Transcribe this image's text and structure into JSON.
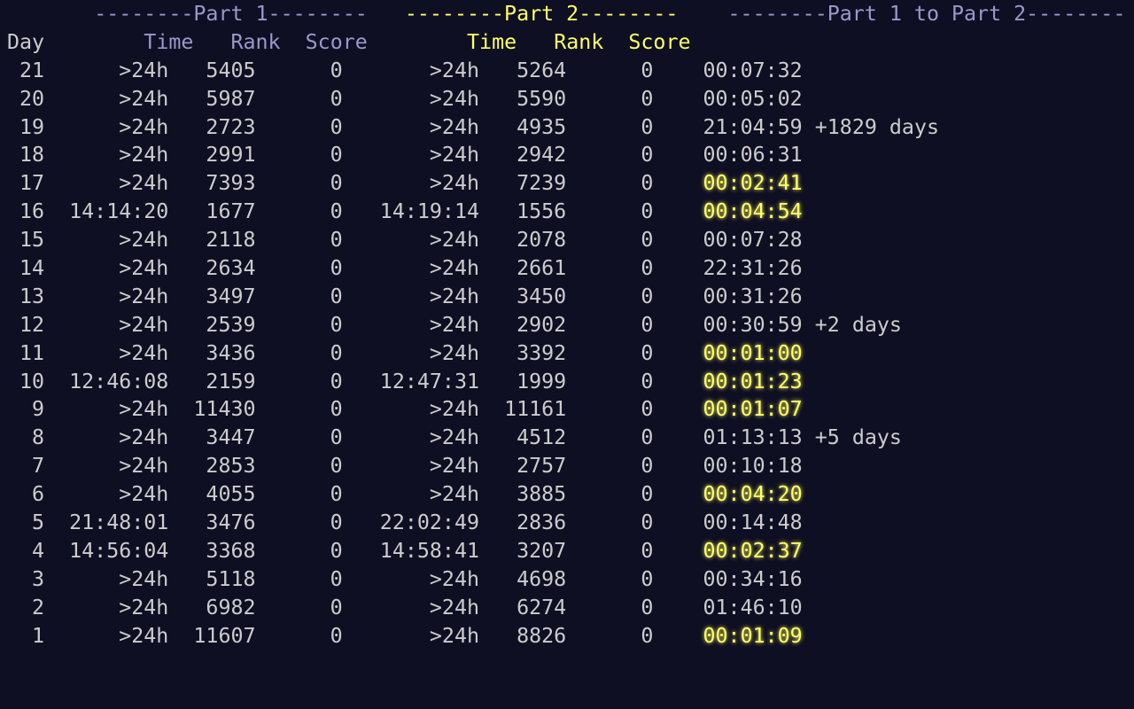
{
  "colors": {
    "background": "#0f0f23",
    "text": "#cccccc",
    "part1_header": "#9999cc",
    "part2_header": "#ffff66",
    "fast_delta": "#ffff66"
  },
  "groups": {
    "part1": "--------Part 1--------",
    "part2": "--------Part 2--------",
    "delta": "--------Part 1 to Part 2--------"
  },
  "headers": {
    "day": "Day",
    "p1_time": "Time",
    "p1_rank": "Rank",
    "p1_score": "Score",
    "p2_time": "Time",
    "p2_rank": "Rank",
    "p2_score": "Score"
  },
  "rows": [
    {
      "day": "21",
      "p1_time": ">24h",
      "p1_rank": "5405",
      "p1_score": "0",
      "p2_time": ">24h",
      "p2_rank": "5264",
      "p2_score": "0",
      "delta": "00:07:32",
      "extra": "",
      "fast": false
    },
    {
      "day": "20",
      "p1_time": ">24h",
      "p1_rank": "5987",
      "p1_score": "0",
      "p2_time": ">24h",
      "p2_rank": "5590",
      "p2_score": "0",
      "delta": "00:05:02",
      "extra": "",
      "fast": false
    },
    {
      "day": "19",
      "p1_time": ">24h",
      "p1_rank": "2723",
      "p1_score": "0",
      "p2_time": ">24h",
      "p2_rank": "4935",
      "p2_score": "0",
      "delta": "21:04:59",
      "extra": "+1829 days",
      "fast": false
    },
    {
      "day": "18",
      "p1_time": ">24h",
      "p1_rank": "2991",
      "p1_score": "0",
      "p2_time": ">24h",
      "p2_rank": "2942",
      "p2_score": "0",
      "delta": "00:06:31",
      "extra": "",
      "fast": false
    },
    {
      "day": "17",
      "p1_time": ">24h",
      "p1_rank": "7393",
      "p1_score": "0",
      "p2_time": ">24h",
      "p2_rank": "7239",
      "p2_score": "0",
      "delta": "00:02:41",
      "extra": "",
      "fast": true
    },
    {
      "day": "16",
      "p1_time": "14:14:20",
      "p1_rank": "1677",
      "p1_score": "0",
      "p2_time": "14:19:14",
      "p2_rank": "1556",
      "p2_score": "0",
      "delta": "00:04:54",
      "extra": "",
      "fast": true
    },
    {
      "day": "15",
      "p1_time": ">24h",
      "p1_rank": "2118",
      "p1_score": "0",
      "p2_time": ">24h",
      "p2_rank": "2078",
      "p2_score": "0",
      "delta": "00:07:28",
      "extra": "",
      "fast": false
    },
    {
      "day": "14",
      "p1_time": ">24h",
      "p1_rank": "2634",
      "p1_score": "0",
      "p2_time": ">24h",
      "p2_rank": "2661",
      "p2_score": "0",
      "delta": "22:31:26",
      "extra": "",
      "fast": false
    },
    {
      "day": "13",
      "p1_time": ">24h",
      "p1_rank": "3497",
      "p1_score": "0",
      "p2_time": ">24h",
      "p2_rank": "3450",
      "p2_score": "0",
      "delta": "00:31:26",
      "extra": "",
      "fast": false
    },
    {
      "day": "12",
      "p1_time": ">24h",
      "p1_rank": "2539",
      "p1_score": "0",
      "p2_time": ">24h",
      "p2_rank": "2902",
      "p2_score": "0",
      "delta": "00:30:59",
      "extra": "+2 days",
      "fast": false
    },
    {
      "day": "11",
      "p1_time": ">24h",
      "p1_rank": "3436",
      "p1_score": "0",
      "p2_time": ">24h",
      "p2_rank": "3392",
      "p2_score": "0",
      "delta": "00:01:00",
      "extra": "",
      "fast": true
    },
    {
      "day": "10",
      "p1_time": "12:46:08",
      "p1_rank": "2159",
      "p1_score": "0",
      "p2_time": "12:47:31",
      "p2_rank": "1999",
      "p2_score": "0",
      "delta": "00:01:23",
      "extra": "",
      "fast": true
    },
    {
      "day": "9",
      "p1_time": ">24h",
      "p1_rank": "11430",
      "p1_score": "0",
      "p2_time": ">24h",
      "p2_rank": "11161",
      "p2_score": "0",
      "delta": "00:01:07",
      "extra": "",
      "fast": true
    },
    {
      "day": "8",
      "p1_time": ">24h",
      "p1_rank": "3447",
      "p1_score": "0",
      "p2_time": ">24h",
      "p2_rank": "4512",
      "p2_score": "0",
      "delta": "01:13:13",
      "extra": "+5 days",
      "fast": false
    },
    {
      "day": "7",
      "p1_time": ">24h",
      "p1_rank": "2853",
      "p1_score": "0",
      "p2_time": ">24h",
      "p2_rank": "2757",
      "p2_score": "0",
      "delta": "00:10:18",
      "extra": "",
      "fast": false
    },
    {
      "day": "6",
      "p1_time": ">24h",
      "p1_rank": "4055",
      "p1_score": "0",
      "p2_time": ">24h",
      "p2_rank": "3885",
      "p2_score": "0",
      "delta": "00:04:20",
      "extra": "",
      "fast": true
    },
    {
      "day": "5",
      "p1_time": "21:48:01",
      "p1_rank": "3476",
      "p1_score": "0",
      "p2_time": "22:02:49",
      "p2_rank": "2836",
      "p2_score": "0",
      "delta": "00:14:48",
      "extra": "",
      "fast": false
    },
    {
      "day": "4",
      "p1_time": "14:56:04",
      "p1_rank": "3368",
      "p1_score": "0",
      "p2_time": "14:58:41",
      "p2_rank": "3207",
      "p2_score": "0",
      "delta": "00:02:37",
      "extra": "",
      "fast": true
    },
    {
      "day": "3",
      "p1_time": ">24h",
      "p1_rank": "5118",
      "p1_score": "0",
      "p2_time": ">24h",
      "p2_rank": "4698",
      "p2_score": "0",
      "delta": "00:34:16",
      "extra": "",
      "fast": false
    },
    {
      "day": "2",
      "p1_time": ">24h",
      "p1_rank": "6982",
      "p1_score": "0",
      "p2_time": ">24h",
      "p2_rank": "6274",
      "p2_score": "0",
      "delta": "01:46:10",
      "extra": "",
      "fast": false
    },
    {
      "day": "1",
      "p1_time": ">24h",
      "p1_rank": "11607",
      "p1_score": "0",
      "p2_time": ">24h",
      "p2_rank": "8826",
      "p2_score": "0",
      "delta": "00:01:09",
      "extra": "",
      "fast": true
    }
  ]
}
